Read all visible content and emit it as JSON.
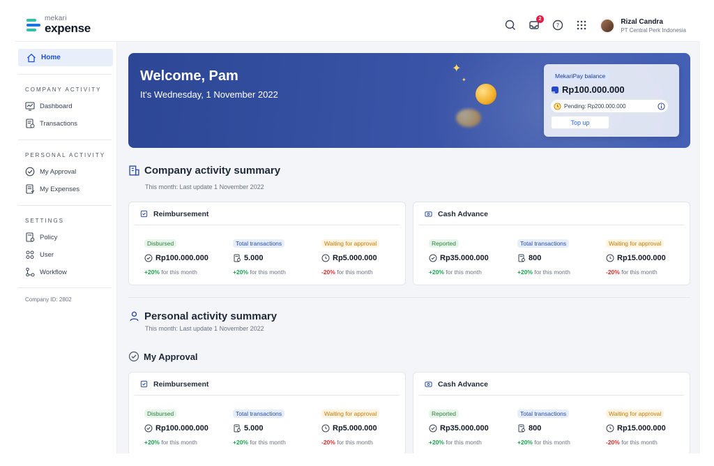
{
  "brand": {
    "sub": "mekari",
    "main": "expense"
  },
  "header": {
    "notification_count": "2",
    "user": {
      "name": "Rizal Candra",
      "company": "PT Central Perk Indonesia"
    }
  },
  "sidebar": {
    "home": "Home",
    "sections": [
      {
        "title": "COMPANY ACTIVITY",
        "items": [
          "Dashboard",
          "Transactions"
        ]
      },
      {
        "title": "PERSONAL ACTIVITY",
        "items": [
          "My Approval",
          "My Expenses"
        ]
      },
      {
        "title": "SETTINGS",
        "items": [
          "Policy",
          "User",
          "Workflow"
        ]
      }
    ],
    "company_id": "Company ID: 2802"
  },
  "banner": {
    "welcome": "Welcome, Pam",
    "date": "It's Wednesday, 1 November 2022",
    "balance": {
      "label": "MekariPay balance",
      "amount": "Rp100.000.000",
      "pending": "Pending: Rp200.000.000",
      "topup": "Top up"
    }
  },
  "company_summary": {
    "title": "Company activity summary",
    "subtitle": "This month: Last update 1 November 2022"
  },
  "personal_summary": {
    "title": "Personal activity summary",
    "subtitle": "This month: Last update 1 November 2022"
  },
  "my_approval": {
    "title": "My Approval"
  },
  "cards": {
    "reimbursement": {
      "title": "Reimbursement",
      "m1": {
        "label": "Disbursed",
        "value": "Rp100.000.000",
        "change": "+20%",
        "suffix": "for this month"
      },
      "m2": {
        "label": "Total transactions",
        "value": "5.000",
        "change": "+20%",
        "suffix": "for this month"
      },
      "m3": {
        "label": "Waiting for approval",
        "value": "Rp5.000.000",
        "change": "-20%",
        "suffix": "for this month"
      }
    },
    "cash_advance": {
      "title": "Cash Advance",
      "m1": {
        "label": "Reported",
        "value": "Rp35.000.000",
        "change": "+20%",
        "suffix": "for this month"
      },
      "m2": {
        "label": "Total transactions",
        "value": "800",
        "change": "+20%",
        "suffix": "for this month"
      },
      "m3": {
        "label": "Waiting for approval",
        "value": "Rp15.000.000",
        "change": "-20%",
        "suffix": "for this month"
      }
    }
  },
  "colors": {
    "accent": "#2d4796",
    "primary": "#1d4ed8",
    "positive": "#16a34a",
    "negative": "#dc2626"
  }
}
